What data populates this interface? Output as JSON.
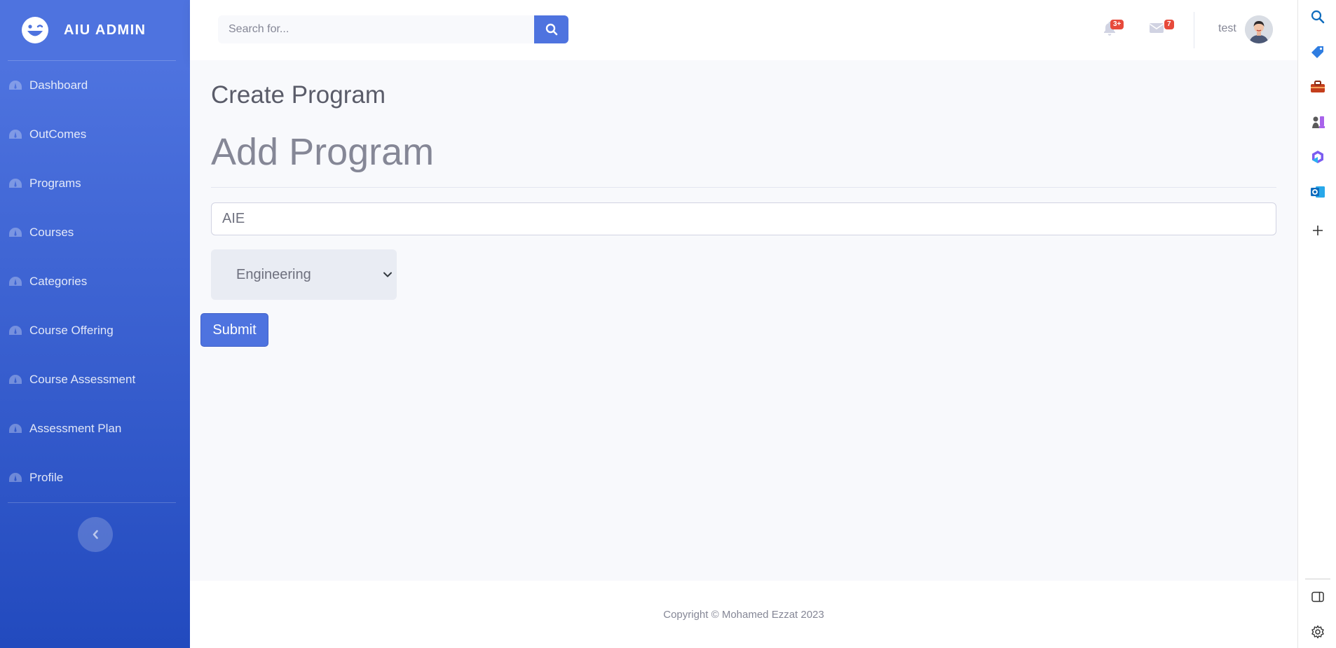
{
  "brand": {
    "name": "AIU ADMIN"
  },
  "sidebar": {
    "items": [
      {
        "label": "Dashboard"
      },
      {
        "label": "OutComes"
      },
      {
        "label": "Programs"
      },
      {
        "label": "Courses"
      },
      {
        "label": "Categories"
      },
      {
        "label": "Course Offering"
      },
      {
        "label": "Course Assessment"
      },
      {
        "label": "Assessment Plan"
      },
      {
        "label": "Profile"
      }
    ]
  },
  "topbar": {
    "search_placeholder": "Search for...",
    "alerts_badge": "3+",
    "messages_badge": "7",
    "username": "test"
  },
  "main": {
    "page_title": "Create Program",
    "form_heading": "Add Program",
    "program_name_value": "AIE",
    "category_selected": "Engineering",
    "submit_label": "Submit"
  },
  "footer": {
    "copyright": "Copyright © Mohamed Ezzat 2023"
  },
  "colors": {
    "primary": "#4e73df",
    "badge": "#e74a3b",
    "text_muted": "#858796"
  }
}
